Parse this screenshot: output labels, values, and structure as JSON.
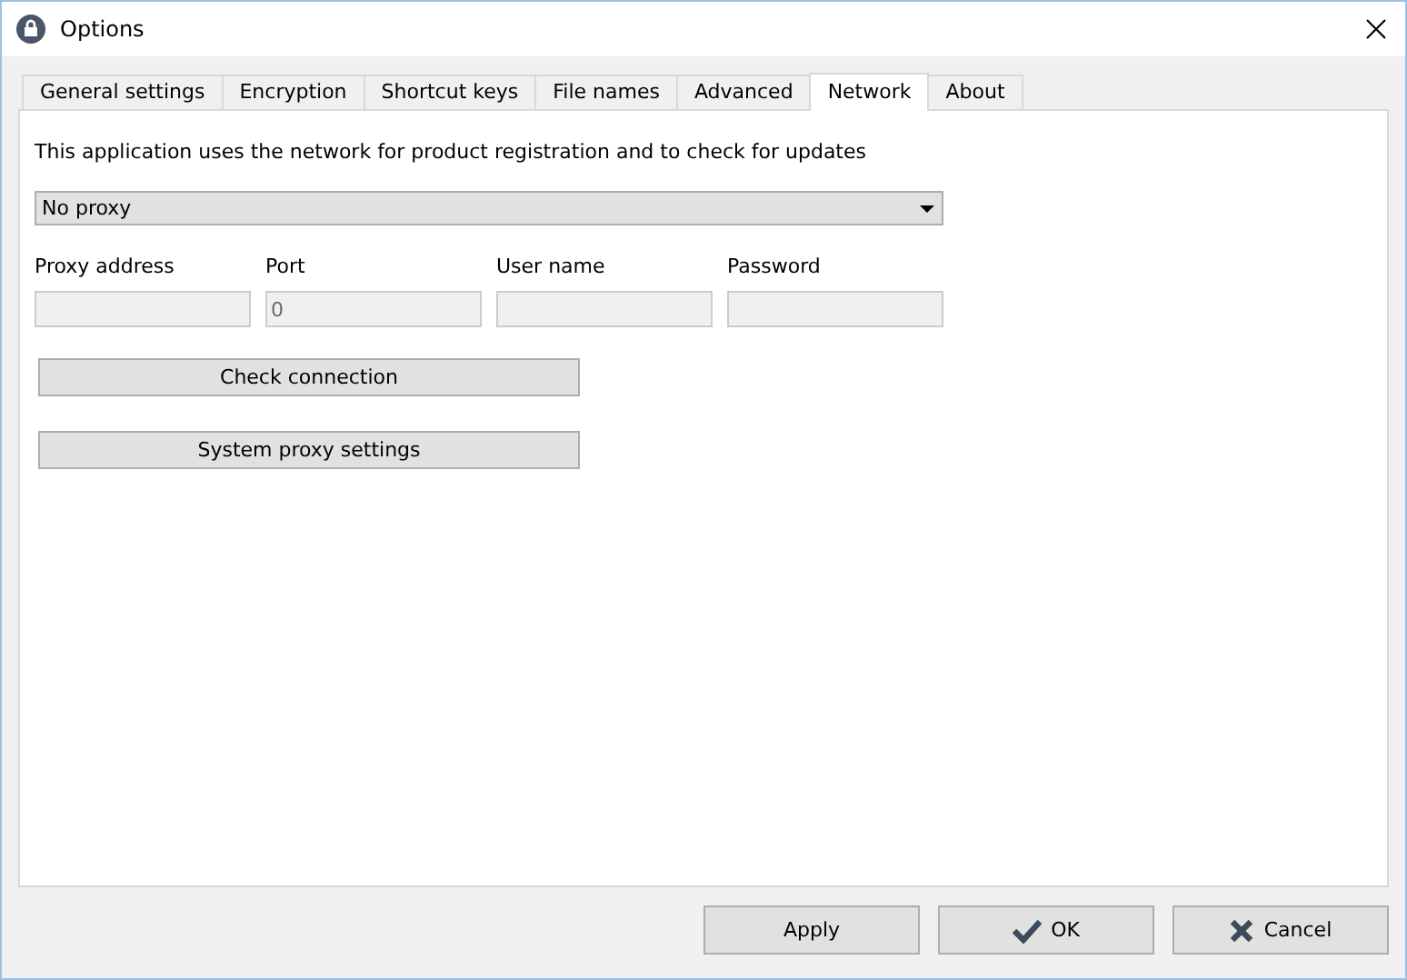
{
  "window": {
    "title": "Options"
  },
  "tabs": [
    {
      "label": "General settings",
      "selected": false
    },
    {
      "label": "Encryption",
      "selected": false
    },
    {
      "label": "Shortcut keys",
      "selected": false
    },
    {
      "label": "File names",
      "selected": false
    },
    {
      "label": "Advanced",
      "selected": false
    },
    {
      "label": "Network",
      "selected": true
    },
    {
      "label": "About",
      "selected": false
    }
  ],
  "network": {
    "description": "This application uses the network for product registration and to check for updates",
    "proxy_dropdown": {
      "value": "No proxy"
    },
    "fields": [
      {
        "label": "Proxy address",
        "disabled": true
      },
      {
        "label": "Port",
        "value": "0",
        "disabled": true
      },
      {
        "label": "User name",
        "disabled": true
      },
      {
        "label": "Password",
        "disabled": true
      }
    ],
    "buttons": [
      "Check connection",
      "System proxy settings"
    ]
  },
  "footer_buttons": [
    {
      "label": "Apply",
      "kind": "plain"
    },
    {
      "label": "OK",
      "kind": "check"
    },
    {
      "label": "Cancel",
      "kind": "cross"
    }
  ]
}
